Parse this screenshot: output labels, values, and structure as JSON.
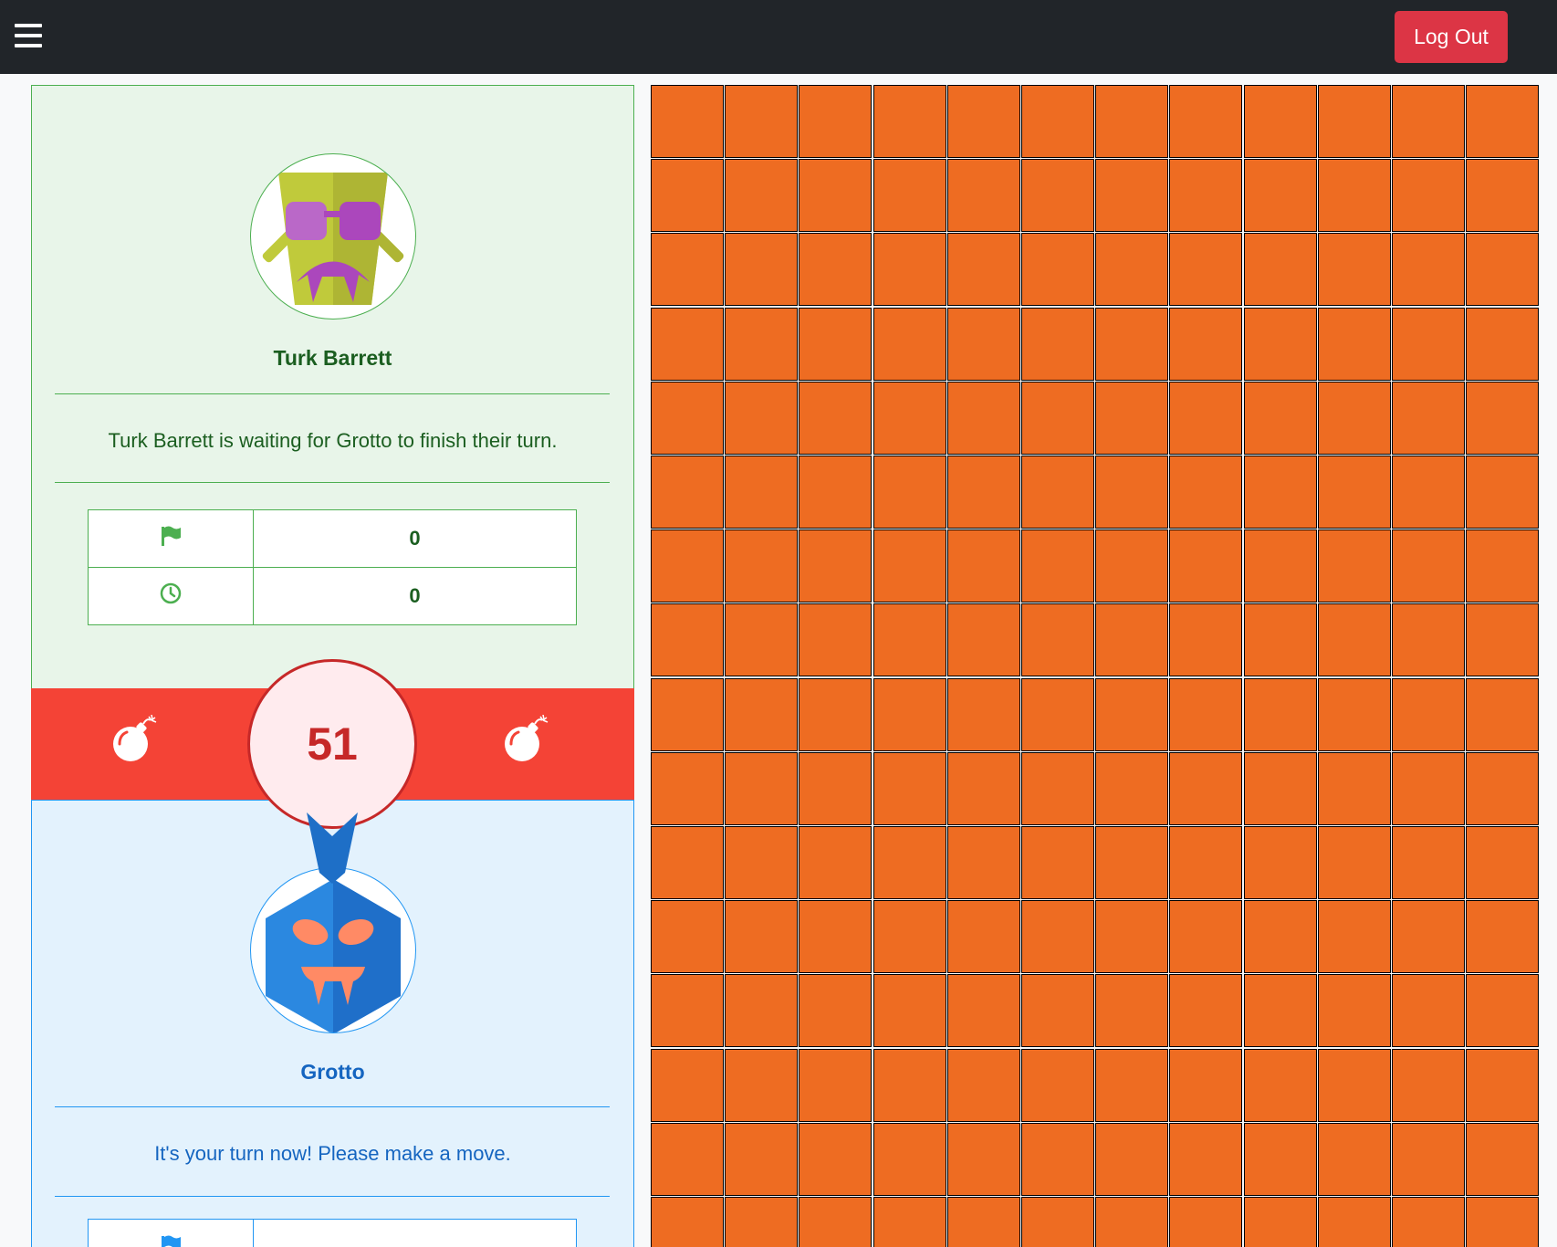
{
  "header": {
    "menu_icon": "hamburger-icon",
    "logout_label": "Log Out",
    "logout_color": "#dc3545"
  },
  "player1": {
    "name": "Turk Barrett",
    "status": "Turk Barrett is waiting for Grotto to finish their turn.",
    "flags": "0",
    "time": "0",
    "flag_icon": "flag-icon",
    "clock_icon": "clock-icon",
    "theme_color": "#4caf50"
  },
  "player2": {
    "name": "Grotto",
    "status": "It's your turn now! Please make a move.",
    "theme_color": "#2196f3"
  },
  "mines": {
    "remaining": "51",
    "icon": "bomb-icon",
    "bar_color": "#f44336"
  },
  "board": {
    "visible_columns": 12,
    "visible_rows": 16,
    "cell_state": "unrevealed",
    "cell_color": "#ee6c22"
  }
}
